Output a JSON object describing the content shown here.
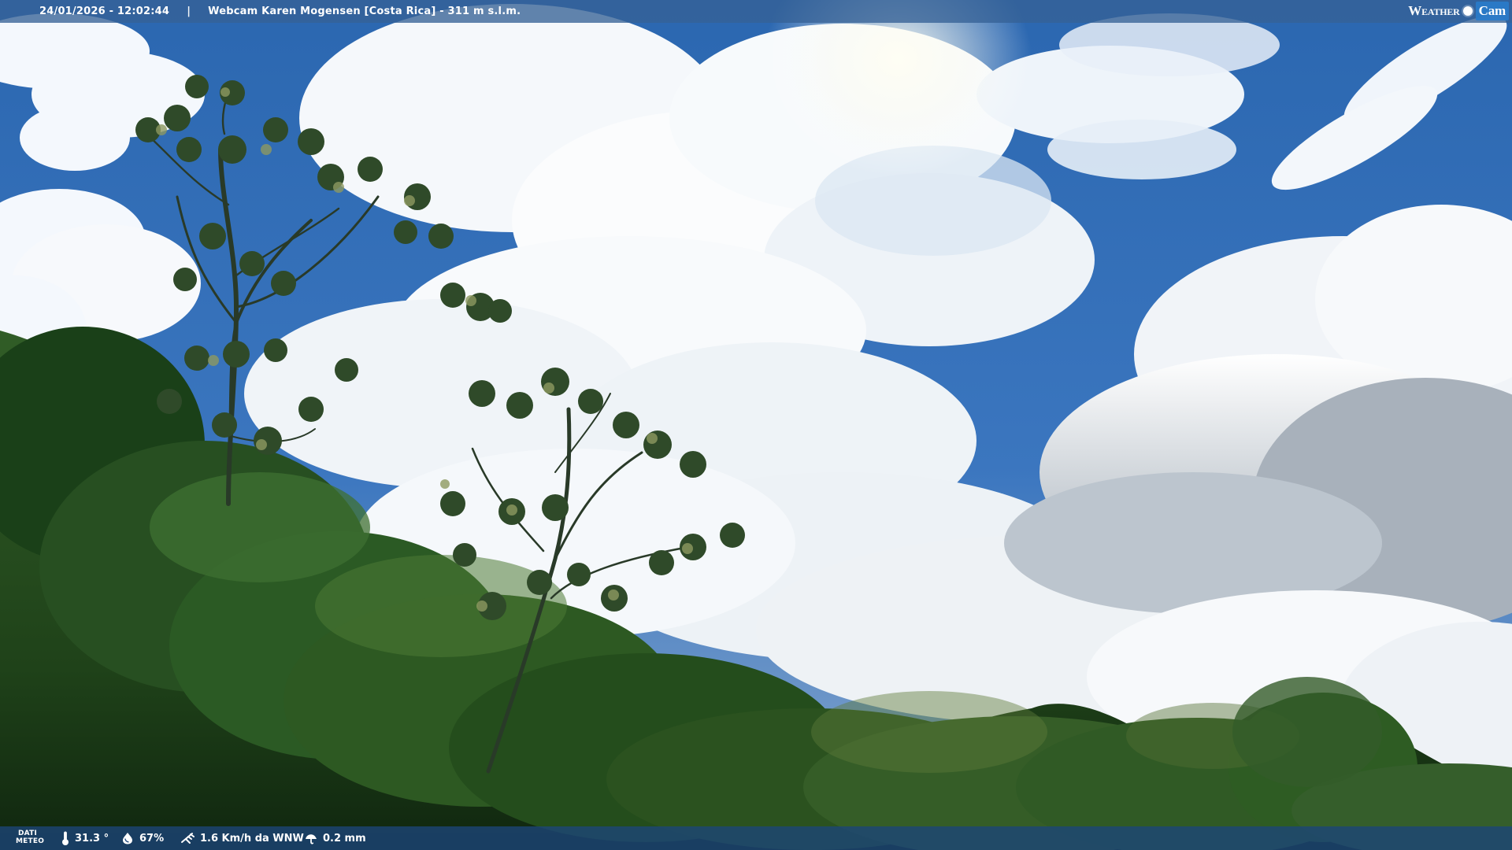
{
  "overlay": {
    "datetime": "24/01/2026 - 12:02:44",
    "separator": "|",
    "location": "Webcam Karen Mogensen [Costa Rica]  - 311 m s.l.m.",
    "brand_weather": "Weather",
    "brand_cam": "Cam"
  },
  "stats": {
    "label": "DATI\nMETEO",
    "label_line1": "DATI",
    "label_line2": "METEO",
    "temperature": "31.3 °",
    "humidity": "67%",
    "wind": "1.6 Km/h da WNW",
    "rain": "0.2 mm"
  },
  "icons": {
    "temperature": "thermometer-icon",
    "humidity": "humidity-icon",
    "wind": "wind-icon",
    "rain": "rain-icon"
  },
  "colors": {
    "sky_blue": "#2e6cb4",
    "cloud_white": "#f8fbff",
    "cloud_gray": "#9ea9b5",
    "forest_dark": "#143513",
    "forest_mid": "#2f5a25",
    "leaf_light": "#7a9158",
    "bar_top": "#366296",
    "bar_bottom": "#1c457a"
  }
}
